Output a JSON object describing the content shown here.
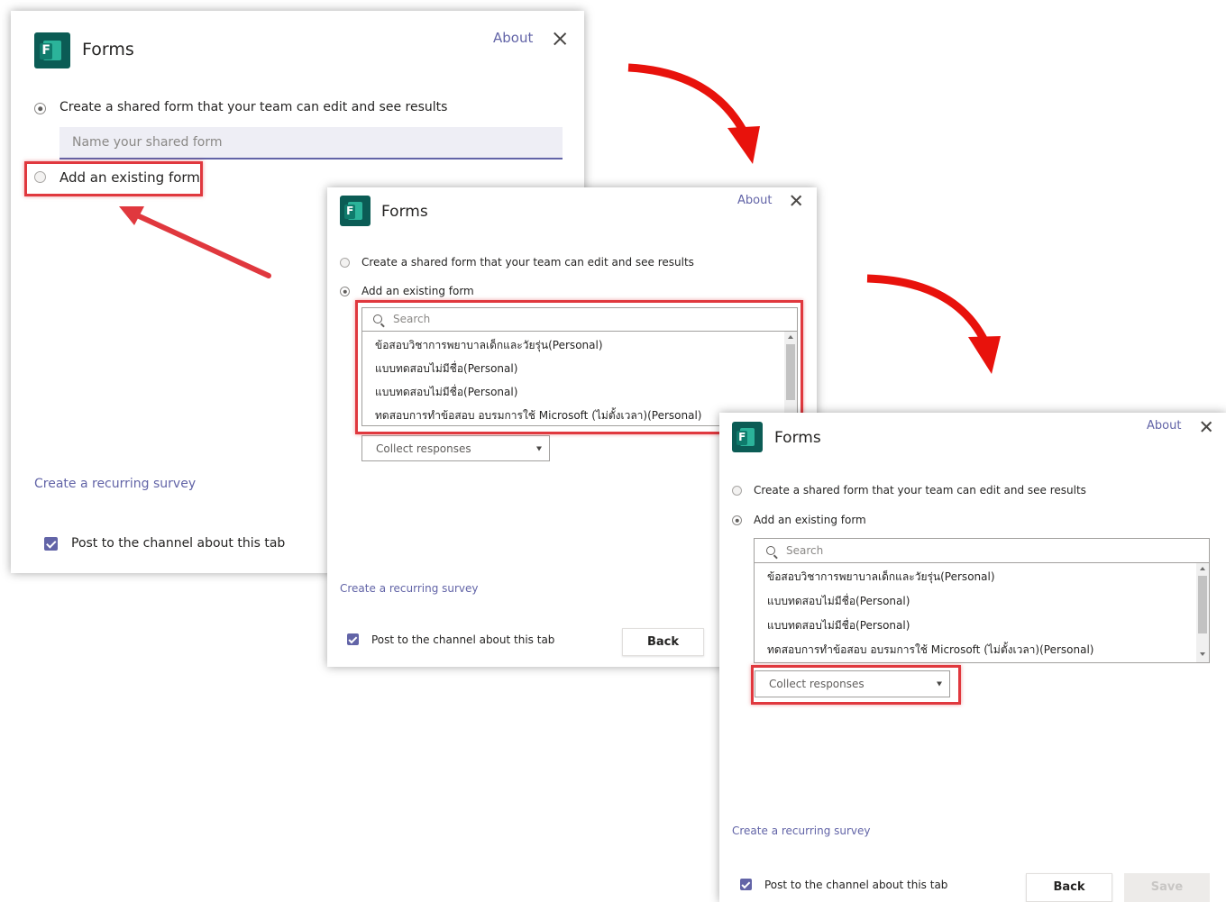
{
  "accent_color": "#6264a7",
  "annotation_color": "#e0383e",
  "dialogs": [
    {
      "app_title": "Forms",
      "about_label": "About",
      "option_create_label": "Create a shared form that your team can edit and see results",
      "name_placeholder": "Name your shared form",
      "option_existing_label": "Add an existing form",
      "recurring_link": "Create a recurring survey",
      "post_label": "Post to the channel about this tab"
    },
    {
      "app_title": "Forms",
      "about_label": "About",
      "option_create_label": "Create a shared form that your team can edit and see results",
      "option_existing_label": "Add an existing form",
      "search_placeholder": "Search",
      "form_items": [
        "ข้อสอบวิชาการพยาบาลเด็กและวัยรุ่น(Personal)",
        "แบบทดสอบไม่มีชื่อ(Personal)",
        "แบบทดสอบไม่มีชื่อ(Personal)",
        "ทดสอบการทำข้อสอบ อบรมการใช้ Microsoft (ไม่ตั้งเวลา)(Personal)"
      ],
      "mode_select_value": "Collect responses",
      "recurring_link": "Create a recurring survey",
      "post_label": "Post to the channel about this tab",
      "back_label": "Back"
    },
    {
      "app_title": "Forms",
      "about_label": "About",
      "option_create_label": "Create a shared form that your team can edit and see results",
      "option_existing_label": "Add an existing form",
      "search_placeholder": "Search",
      "form_items": [
        "ข้อสอบวิชาการพยาบาลเด็กและวัยรุ่น(Personal)",
        "แบบทดสอบไม่มีชื่อ(Personal)",
        "แบบทดสอบไม่มีชื่อ(Personal)",
        "ทดสอบการทำข้อสอบ อบรมการใช้ Microsoft (ไม่ตั้งเวลา)(Personal)"
      ],
      "mode_select_value": "Collect responses",
      "recurring_link": "Create a recurring survey",
      "post_label": "Post to the channel about this tab",
      "back_label": "Back",
      "save_label": "Save"
    }
  ]
}
